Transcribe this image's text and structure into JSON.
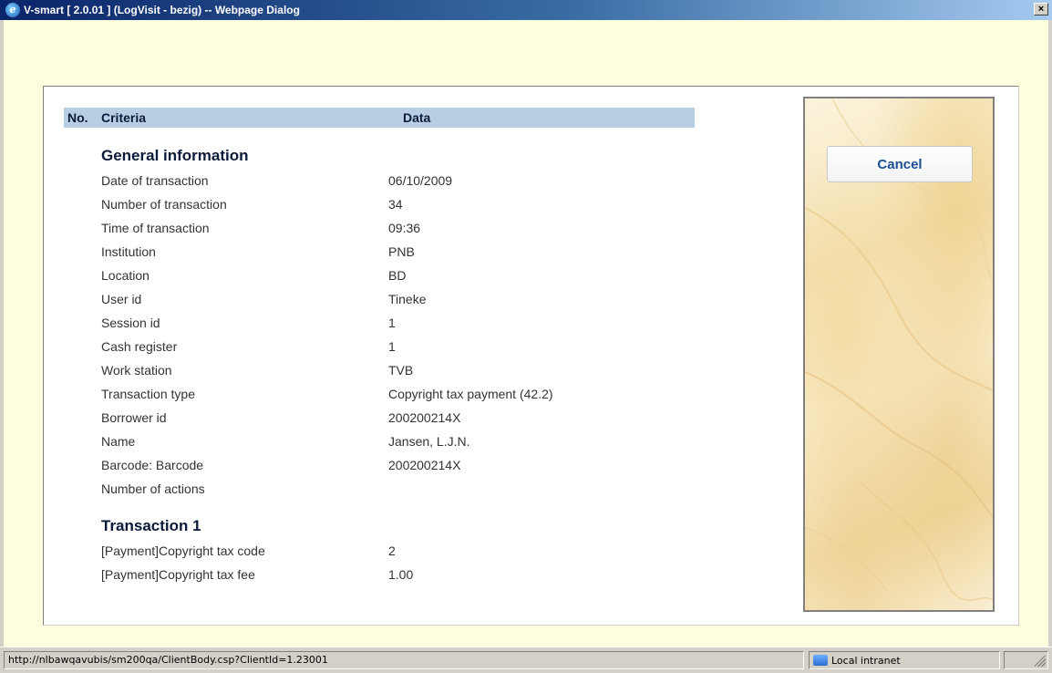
{
  "window": {
    "title": "V-smart [ 2.0.01 ] (LogVisit - bezig) -- Webpage Dialog",
    "app_icon": "ie-icon",
    "close_label": "×"
  },
  "table": {
    "headers": {
      "no": "No.",
      "criteria": "Criteria",
      "data": "Data"
    },
    "sections": [
      {
        "heading": "General information",
        "rows": [
          {
            "label": "Date of transaction",
            "value": "06/10/2009"
          },
          {
            "label": "Number of transaction",
            "value": "34"
          },
          {
            "label": "Time of transaction",
            "value": "09:36"
          },
          {
            "label": "Institution",
            "value": "PNB"
          },
          {
            "label": "Location",
            "value": "BD"
          },
          {
            "label": "User id",
            "value": "Tineke"
          },
          {
            "label": "Session id",
            "value": "1"
          },
          {
            "label": "Cash register",
            "value": "1"
          },
          {
            "label": "Work station",
            "value": "TVB"
          },
          {
            "label": "Transaction type",
            "value": "Copyright tax payment (42.2)"
          },
          {
            "label": "Borrower id",
            "value": "200200214X"
          },
          {
            "label": "Name",
            "value": "Jansen, L.J.N."
          },
          {
            "label": "Barcode: Barcode",
            "value": "200200214X"
          },
          {
            "label": "Number of actions",
            "value": ""
          }
        ]
      },
      {
        "heading": "Transaction 1",
        "rows": [
          {
            "label": "[Payment]Copyright tax code",
            "value": "2"
          },
          {
            "label": "[Payment]Copyright tax fee",
            "value": "1.00"
          }
        ]
      }
    ]
  },
  "actions": {
    "cancel_label": "Cancel"
  },
  "statusbar": {
    "url": "http://nlbawqavubis/sm200qa/ClientBody.csp?ClientId=1.23001",
    "zone": "Local intranet",
    "zone_icon": "intranet-zone-icon"
  },
  "colors": {
    "client_bg": "#ffffe0",
    "header_bg": "#b8cfe3",
    "cancel_text": "#1c4f93"
  }
}
